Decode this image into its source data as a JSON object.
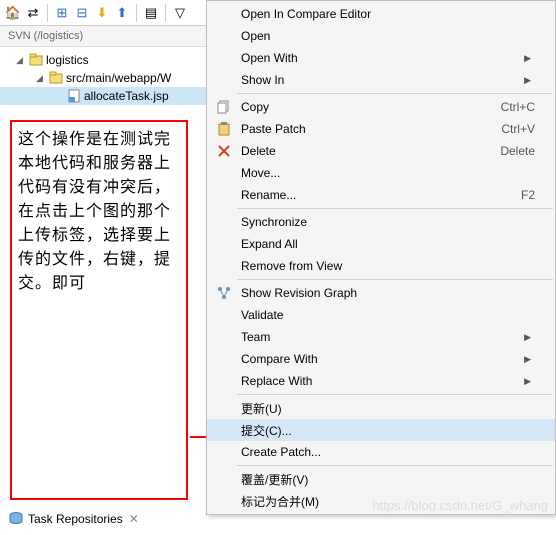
{
  "toolbar": {
    "icons": [
      "home",
      "link",
      "expand-back",
      "expand-forward",
      "refresh",
      "collapse",
      "layout",
      "menu"
    ]
  },
  "svn": {
    "header": "SVN (/logistics)",
    "tree": {
      "root": "logistics",
      "child": "src/main/webapp/W",
      "file": "allocateTask.jsp"
    }
  },
  "instruction": "这个操作是在测试完本地代码和服务器上代码有没有冲突后，在点击上个图的那个上传标签，选择要上传的文件，右键，提交。即可",
  "menu": {
    "open_compare": "Open In Compare Editor",
    "open": "Open",
    "open_with": "Open With",
    "show_in": "Show In",
    "copy": "Copy",
    "copy_sc": "Ctrl+C",
    "paste_patch": "Paste Patch",
    "paste_sc": "Ctrl+V",
    "delete": "Delete",
    "delete_sc": "Delete",
    "move": "Move...",
    "rename": "Rename...",
    "rename_sc": "F2",
    "synchronize": "Synchronize",
    "expand_all": "Expand All",
    "remove_view": "Remove from View",
    "show_rev": "Show Revision Graph",
    "validate": "Validate",
    "team": "Team",
    "compare_with": "Compare With",
    "replace_with": "Replace With",
    "update_u": "更新(U)",
    "commit_c": "提交(C)...",
    "create_patch": "Create Patch...",
    "override_update": "覆盖/更新(V)",
    "mark_merged": "标记为合并(M)"
  },
  "task_repos": "Task Repositories",
  "watermark": "https://blog.csdn.net/G_whang"
}
